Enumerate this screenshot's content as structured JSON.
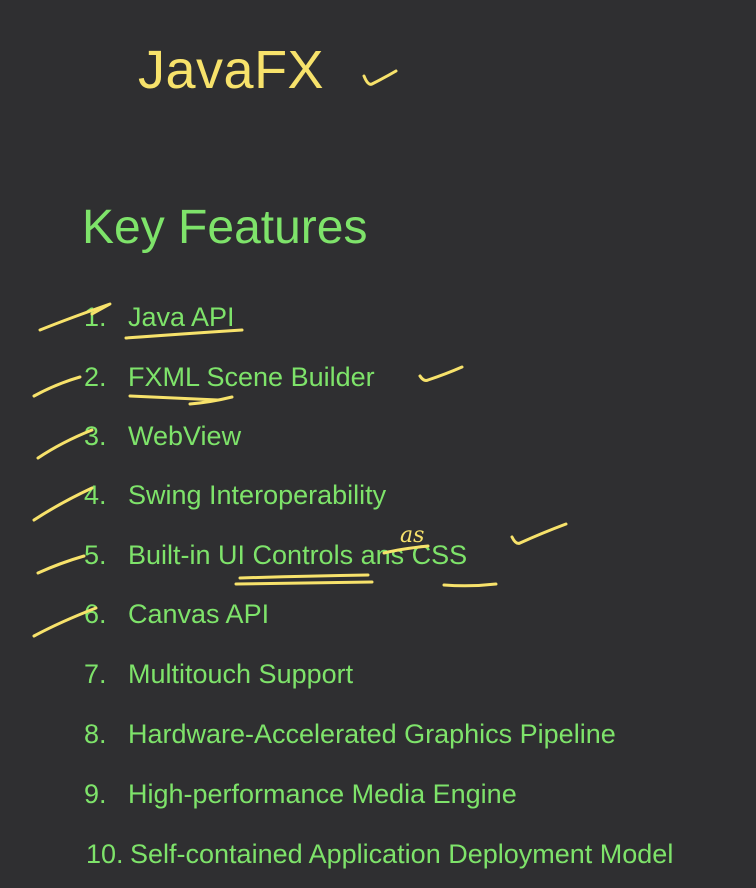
{
  "slide": {
    "title": "JavaFX",
    "subtitle": "Key Features",
    "features": [
      {
        "number": "1.",
        "text": "Java API"
      },
      {
        "number": "2.",
        "text": "FXML Scene Builder"
      },
      {
        "number": "3.",
        "text": "WebView"
      },
      {
        "number": "4.",
        "text": "Swing Interoperability"
      },
      {
        "number": "5.",
        "text": "Built-in UI Controls ans CSS"
      },
      {
        "number": "6.",
        "text": "Canvas API"
      },
      {
        "number": "7.",
        "text": "Multitouch Support"
      },
      {
        "number": "8.",
        "text": "Hardware-Accelerated Graphics Pipeline"
      },
      {
        "number": "9.",
        "text": "High-performance Media Engine"
      },
      {
        "number": "10.",
        "text": "Self-contained Application Deployment Model"
      }
    ],
    "handwritten_correction": "as"
  },
  "colors": {
    "background": "#2f2f31",
    "title": "#f7e26b",
    "text": "#7ee36a",
    "ink": "#f7e26b"
  }
}
